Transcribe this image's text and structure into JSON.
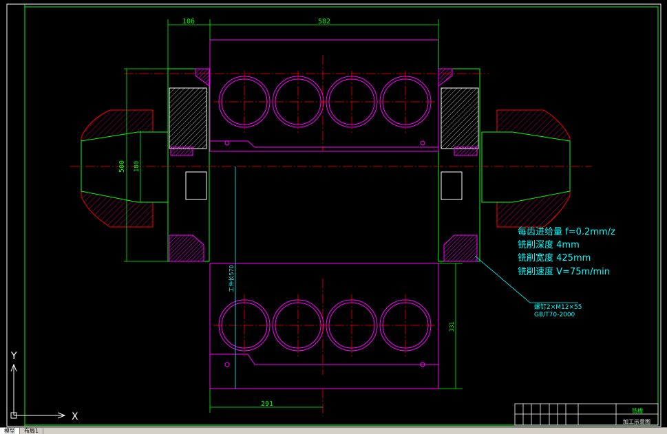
{
  "drawing": {
    "dims": {
      "top_left": "106",
      "top_width": "582",
      "left_height": "500",
      "inner_height": "180",
      "bottom_width": "291",
      "vertical_cyan": "工件长570",
      "right_small": "331"
    },
    "notes": [
      "每齿进给量 f=0.2mm/z",
      "铣削深度 4mm",
      "铣削宽度 425mm",
      "铣削速度 V=75m/min"
    ],
    "leader": {
      "line1": "螺钉2×M12×55",
      "line2": "GB/T70-2000"
    },
    "title_block": {
      "name": "铣槽",
      "drawing_title": "加工示意图"
    },
    "ucs": {
      "x": "X",
      "y": "Y"
    },
    "colors": {
      "magenta": "#ff00ff",
      "green": "#00ff00",
      "red": "#ff0000",
      "cyan": "#00ffff",
      "blue": "#0000ff",
      "white": "#ffffff",
      "background": "#000000"
    }
  },
  "tabs": [
    "模型",
    "布局1"
  ]
}
